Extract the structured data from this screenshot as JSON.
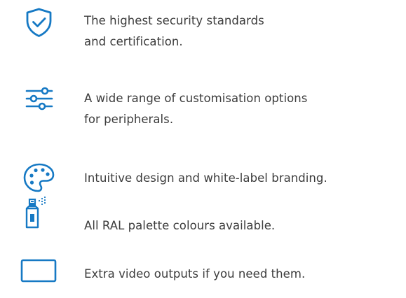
{
  "accent_color": "#1679c4",
  "features": [
    {
      "icon": "shield-check-icon",
      "lines": [
        "The highest security standards",
        "and certification."
      ]
    },
    {
      "icon": "sliders-icon",
      "lines": [
        "A wide range of customisation options",
        "for peripherals."
      ]
    },
    {
      "icon": "palette-icon",
      "lines": [
        "Intuitive design and white-label branding."
      ]
    },
    {
      "icon": "spray-can-icon",
      "lines": [
        "All RAL palette colours available."
      ]
    },
    {
      "icon": "display-icon",
      "lines": [
        "Extra video outputs if you need them."
      ]
    }
  ]
}
